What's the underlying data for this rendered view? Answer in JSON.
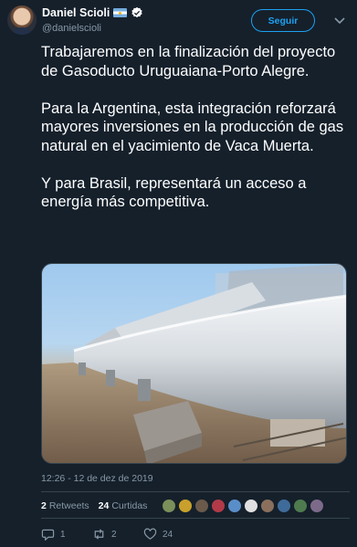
{
  "author": {
    "display_name": "Daniel Scioli",
    "handle": "@danielscioli",
    "flag": "argentina-flag-icon",
    "verified": true
  },
  "follow_button": {
    "label": "Seguir"
  },
  "tweet": {
    "paragraphs": [
      "Trabajaremos en la finalización del proyecto de Gasoducto Uruguaiana-Porto Alegre.",
      "Para la Argentina, esta integración reforzará mayores inversiones en la producción de gas natural en el yacimiento de Vaca Muerta.",
      "Y para Brasil, representará un acceso a energía más competitiva."
    ],
    "timestamp": "12:26 - 12 de dez de 2019"
  },
  "stats": {
    "retweets_count": "2",
    "retweets_label": "Retweets",
    "likes_count": "24",
    "likes_label": "Curtidas",
    "liker_avatar_colors": [
      "#7a8f5a",
      "#c9a02b",
      "#6b5a4a",
      "#b23a48",
      "#5a8ec9",
      "#e0e0e0",
      "#8a6f5c",
      "#3f6b9a",
      "#4f7a4f",
      "#7d6a8a"
    ]
  },
  "actions": {
    "reply_count": "1",
    "retweet_count": "2",
    "like_count": "24"
  },
  "colors": {
    "background": "#15202b",
    "accent": "#1da1f2",
    "secondary_text": "#8899a6"
  }
}
